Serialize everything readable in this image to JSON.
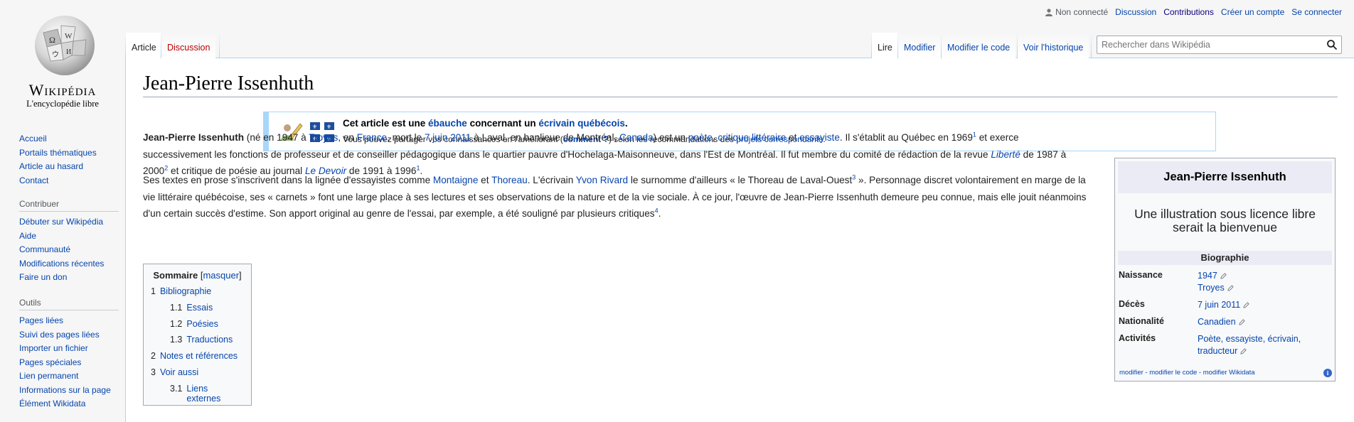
{
  "logo": {
    "wordmark": "Wikipédia",
    "tagline": "L'encyclopédie libre"
  },
  "sidebar": {
    "nav": [
      "Accueil",
      "Portails thématiques",
      "Article au hasard",
      "Contact"
    ],
    "contribuer": {
      "heading": "Contribuer",
      "items": [
        "Débuter sur Wikipédia",
        "Aide",
        "Communauté",
        "Modifications récentes",
        "Faire un don"
      ]
    },
    "outils": {
      "heading": "Outils",
      "items": [
        "Pages liées",
        "Suivi des pages liées",
        "Importer un fichier",
        "Pages spéciales",
        "Lien permanent",
        "Informations sur la page",
        "Élément Wikidata"
      ]
    }
  },
  "personal": {
    "not_connected": "Non connecté",
    "discussion": "Discussion",
    "contributions": "Contributions",
    "create_account": "Créer un compte",
    "login": "Se connecter"
  },
  "tabs": {
    "article": "Article",
    "discussion": "Discussion",
    "read": "Lire",
    "edit": "Modifier",
    "edit_source": "Modifier le code",
    "history": "Voir l'historique"
  },
  "search": {
    "placeholder": "Rechercher dans Wikipédia"
  },
  "page": {
    "title": "Jean-Pierre Issenhuth"
  },
  "ebauche": {
    "l1_a": "Cet article est une ",
    "l1_link1": "ébauche",
    "l1_b": " concernant un ",
    "l1_link2": "écrivain québécois",
    "l1_c": ".",
    "l2_a": "Vous pouvez partager vos connaissances en l'améliorant (",
    "l2_link1": "comment ?",
    "l2_b": ") selon les recommandations des ",
    "l2_link2": "projets correspondants",
    "l2_c": "."
  },
  "para1": {
    "name": "Jean-Pierre Issenhuth",
    "t1": " (né en 1947 à ",
    "troyes": "Troyes",
    "t2": ", en ",
    "france": "France",
    "t3": ", mort le ",
    "date": "7 juin 2011",
    "t4": " à Laval, en banlieue de Montréal, ",
    "canada": "Canada",
    "t5": ") est un ",
    "poete": "poète",
    "t6": ", ",
    "critique": "critique littéraire",
    "t7": " et ",
    "essayiste": "essayiste",
    "t8": ". Il s'établit au Québec en 1969",
    "ref1": "1",
    "t9": " et exerce successivement les fonctions de professeur et de conseiller pédagogique dans le quartier pauvre d'Hochelaga-Maisonneuve, dans l'Est de Montréal. Il fut membre du comité de rédaction de la revue ",
    "liberte": "Liberté",
    "t10": " de 1987 à 2000",
    "ref2": "2",
    "t11": " et critique de poésie au journal ",
    "devoir": "Le Devoir",
    "t12": " de 1991 à 1996",
    "ref3": "1",
    "t13": "."
  },
  "para2": {
    "t1": "Ses textes en prose s'inscrivent dans la lignée d'essayistes comme ",
    "montaigne": "Montaigne",
    "t2": " et ",
    "thoreau": "Thoreau",
    "t3": ". L'écrivain ",
    "rivard": "Yvon Rivard",
    "t4": " le surnomme d'ailleurs « le Thoreau de Laval-Ouest",
    "ref3": "3",
    "t5": " ». Personnage discret volontairement en marge de la vie littéraire québécoise, ses « carnets » font une large place à ses lectures et ses observations de la nature et de la vie sociale. À ce jour, l'œuvre de Jean-Pierre Issenhuth demeure peu connue, mais elle jouit néanmoins d'un certain succès d'estime. Son apport original au genre de l'essai, par exemple, a été souligné par plusieurs critiques",
    "ref4": "4",
    "t6": "."
  },
  "toc": {
    "title": "Sommaire",
    "toggle": "masquer",
    "items": [
      {
        "num": "1",
        "label": "Bibliographie"
      },
      {
        "num": "1.1",
        "label": "Essais"
      },
      {
        "num": "1.2",
        "label": "Poésies"
      },
      {
        "num": "1.3",
        "label": "Traductions"
      },
      {
        "num": "2",
        "label": "Notes et références"
      },
      {
        "num": "3",
        "label": "Voir aussi"
      },
      {
        "num": "3.1",
        "label": "Liens externes"
      }
    ]
  },
  "infobox": {
    "title": "Jean-Pierre Issenhuth",
    "illustration": "Une illustration sous licence libre serait la bienvenue",
    "section": "Biographie",
    "rows": [
      {
        "key": "Naissance",
        "v1": "1947",
        "v2": "Troyes"
      },
      {
        "key": "Décès",
        "v1": "7 juin 2011"
      },
      {
        "key": "Nationalité",
        "v1": "Canadien"
      },
      {
        "key": "Activités",
        "v1": "Poète, essayiste, écrivain, traducteur"
      }
    ],
    "footer": "modifier - modifier le code - modifier Wikidata"
  }
}
